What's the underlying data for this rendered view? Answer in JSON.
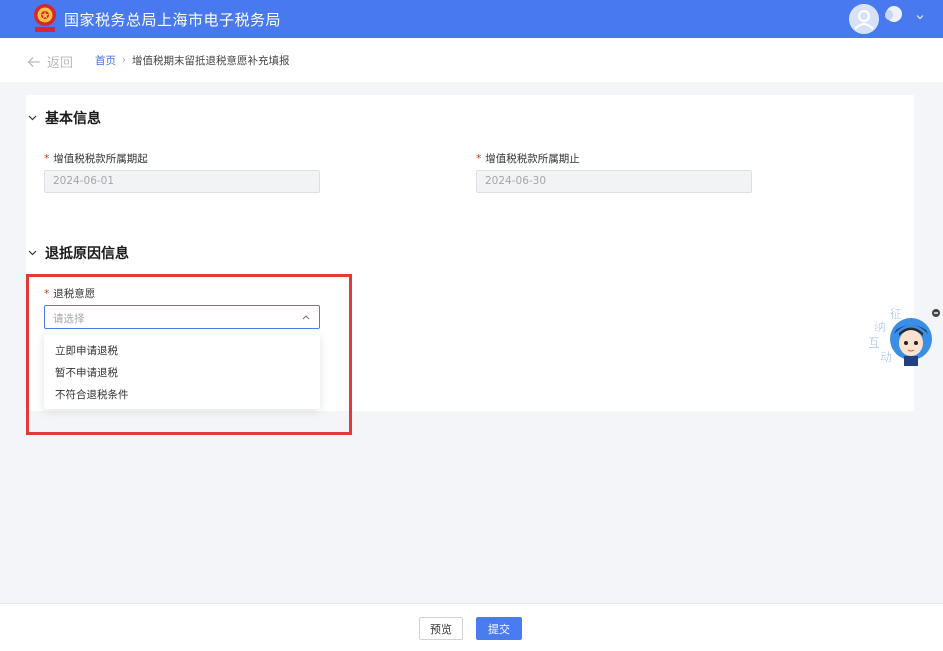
{
  "header": {
    "site_title": "国家税务总局上海市电子税务局"
  },
  "nav": {
    "back_label": "返回",
    "breadcrumb_home": "首页",
    "breadcrumb_separator": "›",
    "breadcrumb_current": "增值税期末留抵退税意愿补充填报"
  },
  "basic_info": {
    "section_title": "基本信息",
    "period_start_label": "增值税税款所属期起",
    "period_start_value": "2024-06-01",
    "period_end_label": "增值税税款所属期止",
    "period_end_value": "2024-06-30"
  },
  "refund_reason": {
    "section_title": "退抵原因信息",
    "intention_label": "退税意愿",
    "intention_placeholder": "请选择",
    "options": [
      "立即申请退税",
      "暂不申请退税",
      "不符合退税条件"
    ]
  },
  "required_mark": "*",
  "mascot": {
    "text_chars": [
      "征",
      "纳",
      "互",
      "动"
    ]
  },
  "footer": {
    "preview_label": "预览",
    "submit_label": "提交"
  },
  "colors": {
    "header_bg": "#4979ee",
    "primary": "#4a7cf0",
    "required": "#e0362b",
    "highlight_border": "#e53935"
  }
}
